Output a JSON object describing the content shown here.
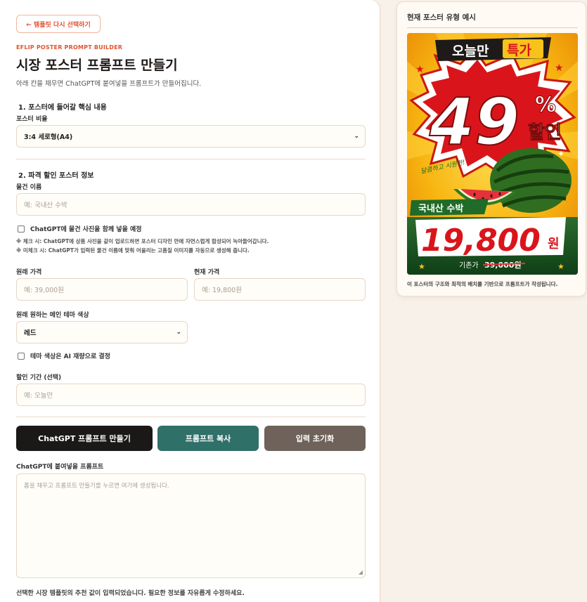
{
  "back_button": "← 템플릿 다시 선택하기",
  "brand": "EFLIP POSTER PROMPT BUILDER",
  "title": "시장 포스터 프롬프트 만들기",
  "subtitle": "아래 칸을 채우면 ChatGPT에 붙여넣을 프롬프트가 만들어집니다.",
  "section1": {
    "heading": "1. 포스터에 들어갈 핵심 내용",
    "ratio_label": "포스터 비율",
    "ratio_value": "3:4 세로형(A4)"
  },
  "section2": {
    "heading": "2. 파격 할인 포스터 정보",
    "product_label": "물건 이름",
    "product_placeholder": "예: 국내산 수박",
    "photo_check_label": "ChatGPT에 물건 사진을 함께 넣을 예정",
    "note_checked": "※ 체크 시: ChatGPT에 상품 사진을 같이 업로드하면 포스터 디자인 안에 자연스럽게 합성되어 녹아들어갑니다.",
    "note_unchecked": "※ 미체크 시: ChatGPT가 입력된 물건 이름에 맞춰 어울리는 고품질 이미지를 자동으로 생성해 줍니다.",
    "original_price_label": "원래 가격",
    "original_price_placeholder": "예: 39,000원",
    "current_price_label": "현재 가격",
    "current_price_placeholder": "예: 19,800원",
    "color_label": "원래 원하는 메인 테마 색상",
    "color_value": "레드",
    "ai_color_check_label": "테마 색상은 AI 재량으로 결정",
    "period_label": "할인 기간 (선택)",
    "period_placeholder": "예: 오늘만"
  },
  "buttons": {
    "generate": "ChatGPT 프롬프트 만들기",
    "copy": "프롬프트 복사",
    "reset": "입력 초기화"
  },
  "prompt": {
    "label": "ChatGPT에 붙여넣을 프롬프트",
    "placeholder": "폼을 채우고 프롬프트 만들기를 누르면 여기에 생성됩니다."
  },
  "footer_note": "선택한 시장 템플릿의 추천 값이 입력되었습니다. 필요한 정보를 자유롭게 수정하세요.",
  "side": {
    "title": "현재 포스터 유형 예시",
    "caption": "이 포스터의 구조와 최적의 배치를 기반으로 프롬프트가 작성됩니다.",
    "poster": {
      "banner_a": "오늘만",
      "banner_b": "특가",
      "discount_number": "49",
      "percent": "%",
      "discount_word": "할인",
      "handwritten": "달콤하고 시원한!",
      "product_tag": "국내산 수박",
      "price": "19,800",
      "price_unit": "원",
      "original_label": "기존가",
      "original_price": "39,000원"
    }
  },
  "colors": {
    "accent": "#e2532e",
    "generate_btn": "#1b1918",
    "copy_btn": "#2f7069",
    "reset_btn": "#6e625a"
  }
}
